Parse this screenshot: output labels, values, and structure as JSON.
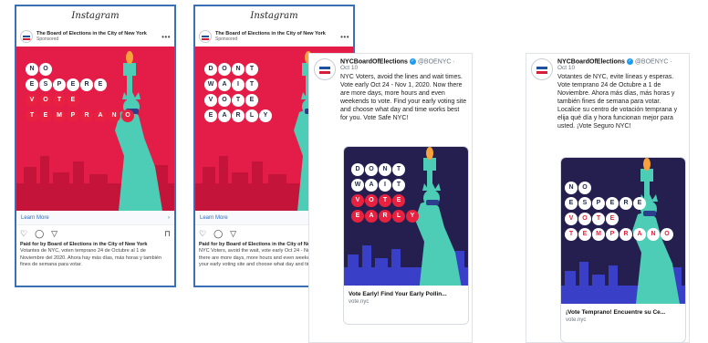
{
  "instagram": {
    "brand": "Instagram",
    "account": "The Board of Elections in the City of New York",
    "sponsored": "Sponsored",
    "more": "•••",
    "learn_more": "Learn More",
    "chevron": "›",
    "paid_by": "Paid for by Board of Elections in the City of New York",
    "icons": [
      "heart-icon",
      "comment-icon",
      "share-icon",
      "bookmark-icon"
    ]
  },
  "posts": [
    {
      "pill_rows": [
        [
          "N",
          "O"
        ],
        [
          "E",
          "S",
          "P",
          "E",
          "R",
          "E"
        ],
        [
          "V",
          "O",
          "T",
          "E"
        ],
        [
          "T",
          "E",
          "M",
          "P",
          "R",
          "A",
          "N",
          "O"
        ]
      ],
      "caption": "Votantes de NYC, voten temprano 24 de Octubre al 1 de Noviembre del 2020. Ahora hay más días, más horas y también fines de semana para votar."
    },
    {
      "pill_rows": [
        [
          "D",
          "O",
          "N",
          "T"
        ],
        [
          "W",
          "A",
          "I",
          "T"
        ],
        [
          "V",
          "O",
          "T",
          "E"
        ],
        [
          "E",
          "A",
          "R",
          "L",
          "Y"
        ]
      ],
      "caption": "NYC Voters, avoid the wait, vote early Oct 24 - Nov 1, 2020. Now there are more days, more hours and even weekends to vote. Find your early voting site and choose what day and time works for you."
    }
  ],
  "tweets": [
    {
      "name": "NYCBoardOfElections",
      "handle": "@BOENYC",
      "date": "Oct 10",
      "text": "NYC Voters, avoid the lines and wait times. Vote early Oct 24 - Nov 1, 2020. Now there are more days, more hours and even weekends to vote. Find your early voting site and choose what day and time works best for you. Vote Safe NYC!",
      "pill_rows": [
        [
          "D",
          "O",
          "N",
          "T"
        ],
        [
          "W",
          "A",
          "I",
          "T"
        ],
        [
          "V",
          "O",
          "T",
          "E"
        ],
        [
          "E",
          "A",
          "R",
          "L",
          "Y"
        ]
      ],
      "card_title": "Vote Early! Find Your Early Pollin...",
      "card_url": "vote.nyc"
    },
    {
      "name": "NYCBoardOfElections",
      "handle": "@BOENYC",
      "date": "Oct 10",
      "text": "Votantes de NYC, evite líneas y esperas. Vote temprano 24 de Octubre a 1 de Noviembre. Ahora más días, más horas y también fines de semana para votar. Localice su centro de votación temprana y elija qué día y hora funcionan mejor para usted. ¡Vote Seguro NYC!",
      "pill_rows": [
        [
          "N",
          "O"
        ],
        [
          "E",
          "S",
          "P",
          "E",
          "R",
          "E"
        ],
        [
          "V",
          "O",
          "T",
          "E"
        ],
        [
          "T",
          "E",
          "M",
          "P",
          "R",
          "A",
          "N",
          "O"
        ]
      ],
      "card_title": "¡Vote Temprano! Encuentre su Ce...",
      "card_url": "vote.nyc"
    }
  ]
}
